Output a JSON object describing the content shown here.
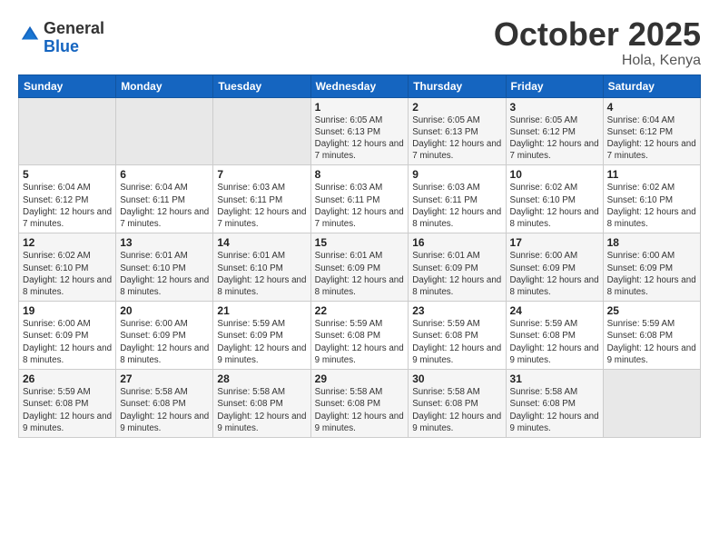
{
  "header": {
    "logo_general": "General",
    "logo_blue": "Blue",
    "month_title": "October 2025",
    "location": "Hola, Kenya"
  },
  "weekdays": [
    "Sunday",
    "Monday",
    "Tuesday",
    "Wednesday",
    "Thursday",
    "Friday",
    "Saturday"
  ],
  "weeks": [
    [
      {
        "day": "",
        "info": ""
      },
      {
        "day": "",
        "info": ""
      },
      {
        "day": "",
        "info": ""
      },
      {
        "day": "1",
        "info": "Sunrise: 6:05 AM\nSunset: 6:13 PM\nDaylight: 12 hours and 7 minutes."
      },
      {
        "day": "2",
        "info": "Sunrise: 6:05 AM\nSunset: 6:13 PM\nDaylight: 12 hours and 7 minutes."
      },
      {
        "day": "3",
        "info": "Sunrise: 6:05 AM\nSunset: 6:12 PM\nDaylight: 12 hours and 7 minutes."
      },
      {
        "day": "4",
        "info": "Sunrise: 6:04 AM\nSunset: 6:12 PM\nDaylight: 12 hours and 7 minutes."
      }
    ],
    [
      {
        "day": "5",
        "info": "Sunrise: 6:04 AM\nSunset: 6:12 PM\nDaylight: 12 hours and 7 minutes."
      },
      {
        "day": "6",
        "info": "Sunrise: 6:04 AM\nSunset: 6:11 PM\nDaylight: 12 hours and 7 minutes."
      },
      {
        "day": "7",
        "info": "Sunrise: 6:03 AM\nSunset: 6:11 PM\nDaylight: 12 hours and 7 minutes."
      },
      {
        "day": "8",
        "info": "Sunrise: 6:03 AM\nSunset: 6:11 PM\nDaylight: 12 hours and 7 minutes."
      },
      {
        "day": "9",
        "info": "Sunrise: 6:03 AM\nSunset: 6:11 PM\nDaylight: 12 hours and 8 minutes."
      },
      {
        "day": "10",
        "info": "Sunrise: 6:02 AM\nSunset: 6:10 PM\nDaylight: 12 hours and 8 minutes."
      },
      {
        "day": "11",
        "info": "Sunrise: 6:02 AM\nSunset: 6:10 PM\nDaylight: 12 hours and 8 minutes."
      }
    ],
    [
      {
        "day": "12",
        "info": "Sunrise: 6:02 AM\nSunset: 6:10 PM\nDaylight: 12 hours and 8 minutes."
      },
      {
        "day": "13",
        "info": "Sunrise: 6:01 AM\nSunset: 6:10 PM\nDaylight: 12 hours and 8 minutes."
      },
      {
        "day": "14",
        "info": "Sunrise: 6:01 AM\nSunset: 6:10 PM\nDaylight: 12 hours and 8 minutes."
      },
      {
        "day": "15",
        "info": "Sunrise: 6:01 AM\nSunset: 6:09 PM\nDaylight: 12 hours and 8 minutes."
      },
      {
        "day": "16",
        "info": "Sunrise: 6:01 AM\nSunset: 6:09 PM\nDaylight: 12 hours and 8 minutes."
      },
      {
        "day": "17",
        "info": "Sunrise: 6:00 AM\nSunset: 6:09 PM\nDaylight: 12 hours and 8 minutes."
      },
      {
        "day": "18",
        "info": "Sunrise: 6:00 AM\nSunset: 6:09 PM\nDaylight: 12 hours and 8 minutes."
      }
    ],
    [
      {
        "day": "19",
        "info": "Sunrise: 6:00 AM\nSunset: 6:09 PM\nDaylight: 12 hours and 8 minutes."
      },
      {
        "day": "20",
        "info": "Sunrise: 6:00 AM\nSunset: 6:09 PM\nDaylight: 12 hours and 8 minutes."
      },
      {
        "day": "21",
        "info": "Sunrise: 5:59 AM\nSunset: 6:09 PM\nDaylight: 12 hours and 9 minutes."
      },
      {
        "day": "22",
        "info": "Sunrise: 5:59 AM\nSunset: 6:08 PM\nDaylight: 12 hours and 9 minutes."
      },
      {
        "day": "23",
        "info": "Sunrise: 5:59 AM\nSunset: 6:08 PM\nDaylight: 12 hours and 9 minutes."
      },
      {
        "day": "24",
        "info": "Sunrise: 5:59 AM\nSunset: 6:08 PM\nDaylight: 12 hours and 9 minutes."
      },
      {
        "day": "25",
        "info": "Sunrise: 5:59 AM\nSunset: 6:08 PM\nDaylight: 12 hours and 9 minutes."
      }
    ],
    [
      {
        "day": "26",
        "info": "Sunrise: 5:59 AM\nSunset: 6:08 PM\nDaylight: 12 hours and 9 minutes."
      },
      {
        "day": "27",
        "info": "Sunrise: 5:58 AM\nSunset: 6:08 PM\nDaylight: 12 hours and 9 minutes."
      },
      {
        "day": "28",
        "info": "Sunrise: 5:58 AM\nSunset: 6:08 PM\nDaylight: 12 hours and 9 minutes."
      },
      {
        "day": "29",
        "info": "Sunrise: 5:58 AM\nSunset: 6:08 PM\nDaylight: 12 hours and 9 minutes."
      },
      {
        "day": "30",
        "info": "Sunrise: 5:58 AM\nSunset: 6:08 PM\nDaylight: 12 hours and 9 minutes."
      },
      {
        "day": "31",
        "info": "Sunrise: 5:58 AM\nSunset: 6:08 PM\nDaylight: 12 hours and 9 minutes."
      },
      {
        "day": "",
        "info": ""
      }
    ]
  ]
}
